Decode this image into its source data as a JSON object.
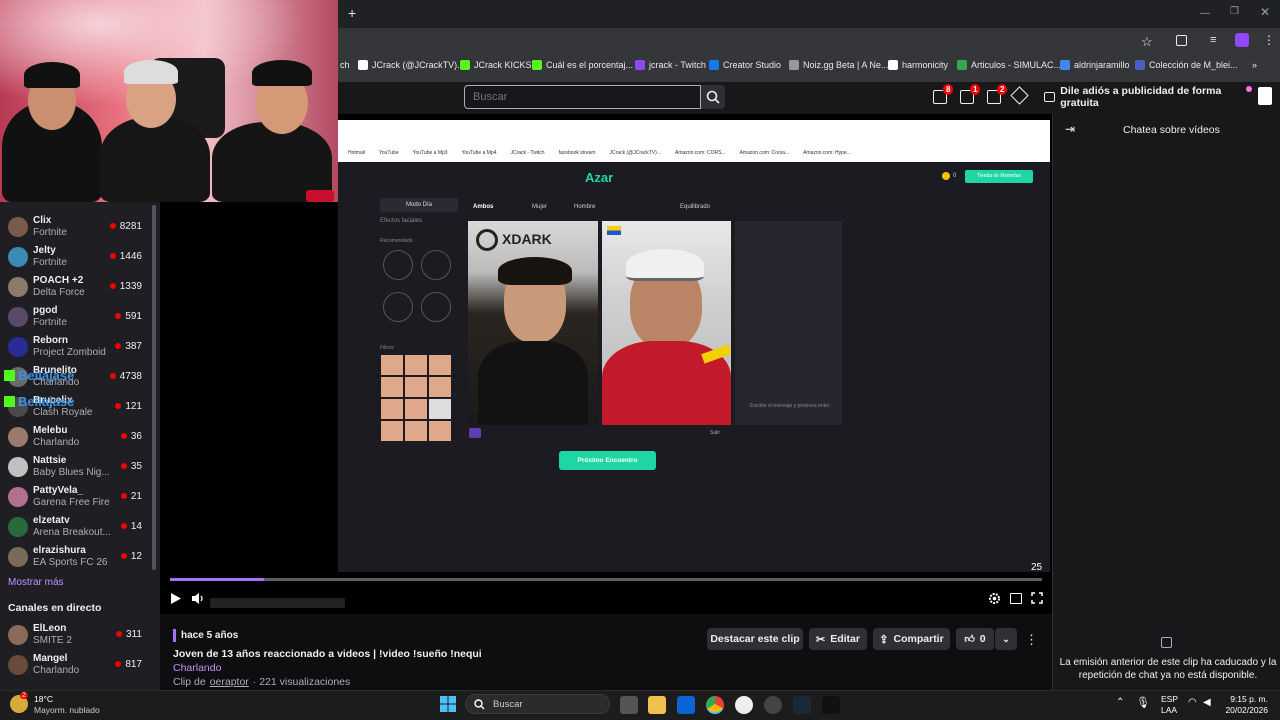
{
  "browser": {
    "new_tab": "+",
    "bookmarks": [
      {
        "label": "ch",
        "color": "#888"
      },
      {
        "label": "JCrack (@JCrackTV)...",
        "color": "#ffffff"
      },
      {
        "label": "JCrack KICKS",
        "color": "#53fc18"
      },
      {
        "label": "Cuál es el porcentaj...",
        "color": "#53fc18"
      },
      {
        "label": "jcrack - Twitch",
        "color": "#9146ff"
      },
      {
        "label": "Creator Studio",
        "color": "#1877f2"
      },
      {
        "label": "Noiz.gg Beta | A Ne...",
        "color": "#999"
      },
      {
        "label": "harmonicity",
        "color": "#ffffff"
      },
      {
        "label": "Articulos - SIMULAC...",
        "color": "#34a853"
      },
      {
        "label": "aldrinjaramillo",
        "color": "#4285f4"
      },
      {
        "label": "Colección de M_blei...",
        "color": "#4a5fc1"
      }
    ]
  },
  "twitch_nav": {
    "search_placeholder": "Buscar",
    "badges": [
      "8",
      "1",
      "2"
    ],
    "ad_free": "Dile adiós a publicidad de forma gratuita"
  },
  "sidebar": {
    "channels": [
      {
        "name": "Clix",
        "game": "Fortnite",
        "viewers": "8281",
        "color": "#7a5a4a"
      },
      {
        "name": "Jelty",
        "game": "Fortnite",
        "viewers": "1446",
        "color": "#3c8ab5"
      },
      {
        "name": "POACH +2",
        "game": "Delta Force",
        "viewers": "1339",
        "color": "#8a7b6a"
      },
      {
        "name": "pgod",
        "game": "Fortnite",
        "viewers": "591",
        "color": "#5a4a6a"
      },
      {
        "name": "Reborn",
        "game": "Project Zomboid",
        "viewers": "387",
        "color": "#2a2a9a"
      },
      {
        "name": "Brunelito",
        "game": "Charlando",
        "viewers": "4738",
        "color": "#6a6a6a"
      },
      {
        "name": "Brucelix",
        "game": "Clash Royale",
        "viewers": "121",
        "color": "#4a4a4a"
      },
      {
        "name": "Melebu",
        "game": "Charlando",
        "viewers": "36",
        "color": "#9a7a6a"
      },
      {
        "name": "Nattsie",
        "game": "Baby Blues Nig...",
        "viewers": "35",
        "color": "#c0c0c0"
      },
      {
        "name": "PattyVela_",
        "game": "Garena Free Fire",
        "viewers": "21",
        "color": "#b07090"
      },
      {
        "name": "elzetatv",
        "game": "Arena Breakout...",
        "viewers": "14",
        "color": "#2a6a3a"
      },
      {
        "name": "elrazishura",
        "game": "EA Sports FC 26",
        "viewers": "12",
        "color": "#7a6a5a"
      }
    ],
    "show_more": "Mostrar más",
    "live_header": "Canales en directo",
    "live_channels": [
      {
        "name": "ElLeon",
        "game": "SMITE 2",
        "viewers": "311",
        "color": "#8a6a5a"
      },
      {
        "name": "Mangel",
        "game": "Charlando",
        "viewers": "817",
        "color": "#6a4a3a"
      }
    ],
    "overlay_user": "Bellajase"
  },
  "video": {
    "timer": "25",
    "azar": {
      "logo": "Azar",
      "mode_day": "Modo Día",
      "effects": "Efectos faciales",
      "recommended": "Recomendado",
      "filters": "Filtros",
      "tab_both": "Ambos",
      "tab_women": "Mujer",
      "tab_men": "Hombre",
      "balanced": "Equilibrado",
      "coins": "0",
      "store": "Tienda de Monedas",
      "next": "Próximo Encuentro",
      "write": "Escribe el mensaje y presiona enter",
      "exit": "Salir",
      "bookmarks": [
        "Hotmail",
        "YouTube",
        "YouTube a Mp3",
        "YouTube a Mp4",
        "JCrack - Twitch",
        "facebook stream",
        "JCrack (@JCrackTV)...",
        "Amazon.com: CORS...",
        "Amazon.com: Corsa...",
        "Amazon.com: Hype..."
      ],
      "webcam_sign": "XDARK"
    }
  },
  "clip": {
    "age": "hace 5 años",
    "title": "Joven de 13 años reaccionado a videos | !video !sueño !nequi",
    "category": "Charlando",
    "clip_by_prefix": "Clip de",
    "clipper": "oeraptor",
    "views": "· 221 visualizaciones",
    "feature_btn": "Destacar este clip",
    "edit_btn": "Editar",
    "share_btn": "Compartir",
    "likes": "0"
  },
  "chat": {
    "title": "Chatea sobre vídeos",
    "expired": "La emisión anterior de este clip ha caducado y la repetición de chat ya no está disponible."
  },
  "taskbar": {
    "temp": "18°C",
    "weather": "Mayorm. nublado",
    "weather_badge": "2",
    "search": "Buscar",
    "lang1": "ESP",
    "lang2": "LAA",
    "time": "9:15 p. m.",
    "date": "20/02/2026"
  }
}
